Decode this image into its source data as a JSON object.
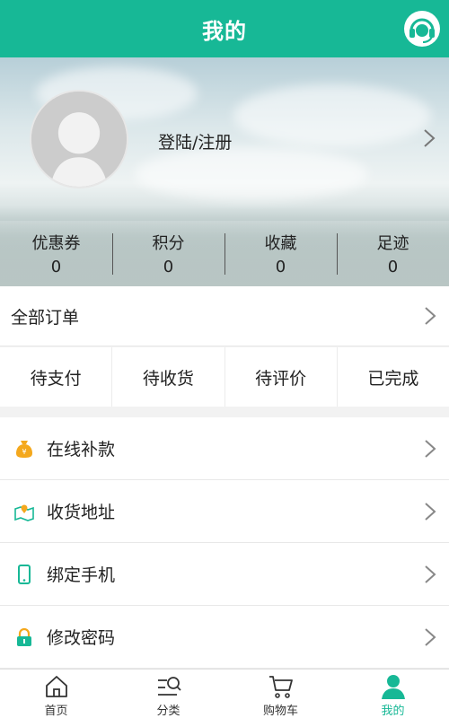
{
  "header": {
    "title": "我的",
    "headset_icon": "customer-service-headset-icon"
  },
  "profile": {
    "login_label": "登陆/注册",
    "avatar_icon": "default-avatar-icon"
  },
  "stats": [
    {
      "label": "优惠券",
      "value": "0"
    },
    {
      "label": "积分",
      "value": "0"
    },
    {
      "label": "收藏",
      "value": "0"
    },
    {
      "label": "足迹",
      "value": "0"
    }
  ],
  "orders": {
    "all_label": "全部订单",
    "tabs": [
      {
        "label": "待支付"
      },
      {
        "label": "待收货"
      },
      {
        "label": "待评价"
      },
      {
        "label": "已完成"
      }
    ]
  },
  "menu": [
    {
      "label": "在线补款",
      "icon": "money-bag-icon"
    },
    {
      "label": "收货地址",
      "icon": "map-location-icon"
    },
    {
      "label": "绑定手机",
      "icon": "phone-icon"
    },
    {
      "label": "修改密码",
      "icon": "lock-icon"
    }
  ],
  "tabbar": [
    {
      "label": "首页",
      "icon": "home-icon"
    },
    {
      "label": "分类",
      "icon": "category-search-icon"
    },
    {
      "label": "购物车",
      "icon": "cart-icon"
    },
    {
      "label": "我的",
      "icon": "user-icon",
      "active": true
    }
  ],
  "colors": {
    "accent": "#17b896",
    "icon_orange": "#f4a81d"
  }
}
